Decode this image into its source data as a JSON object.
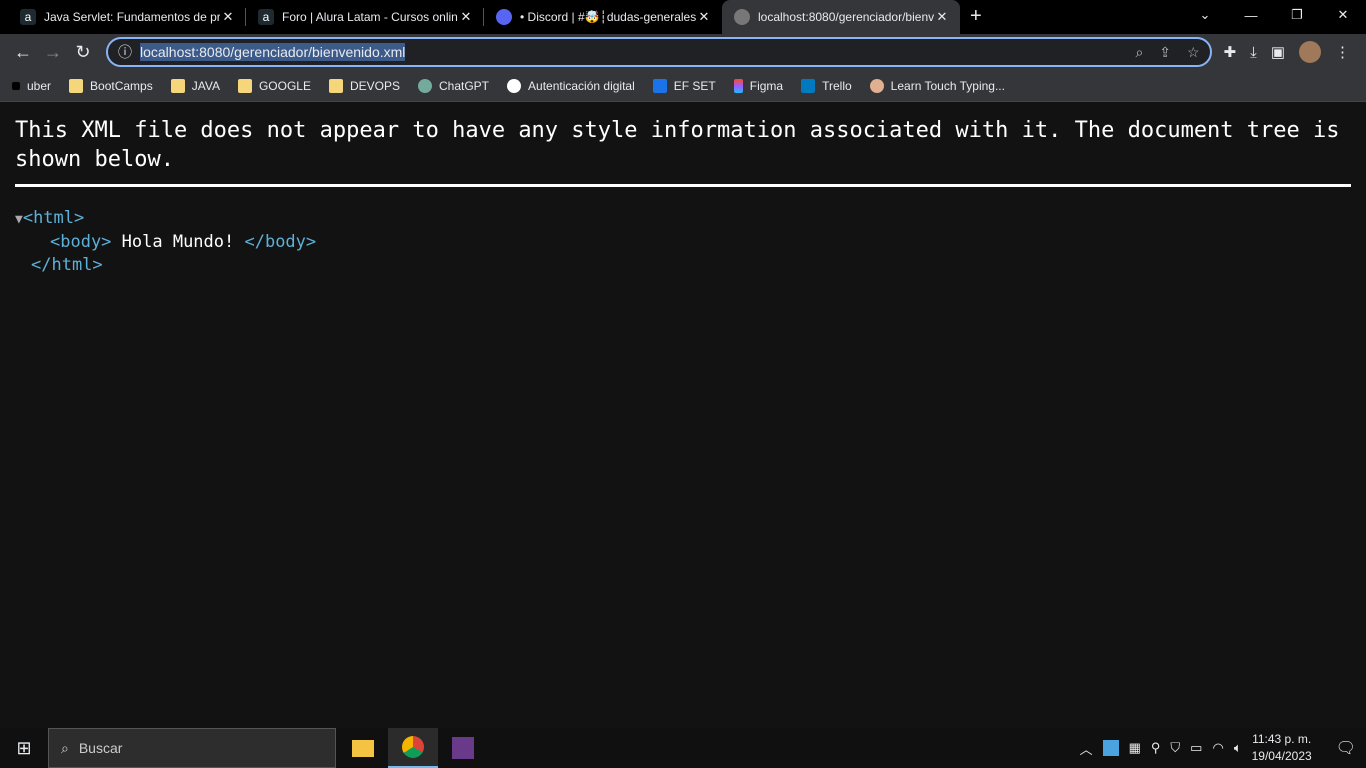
{
  "tabs": [
    {
      "title": "Java Servlet: Fundamentos de pro",
      "icon": "alura-icon"
    },
    {
      "title": "Foro | Alura Latam - Cursos onlin",
      "icon": "alura-icon"
    },
    {
      "title": "• Discord | #🤯┆dudas-generales",
      "icon": "discord-icon"
    },
    {
      "title": "localhost:8080/gerenciador/bienv",
      "icon": "globe-icon",
      "active": true
    }
  ],
  "address": {
    "url": "localhost:8080/gerenciador/bienvenido.xml"
  },
  "bookmarks": [
    "uber",
    "BootCamps",
    "JAVA",
    "GOOGLE",
    "DEVOPS",
    "ChatGPT",
    "Autenticación digital",
    "EF SET",
    "Figma",
    "Trello",
    "Learn Touch Typing..."
  ],
  "page": {
    "notice": "This XML file does not appear to have any style information associated with it. The document tree is shown below.",
    "html_open": "<html>",
    "body_open": "<body>",
    "body_text": " Hola Mundo! ",
    "body_close": "</body>",
    "html_close": "</html>"
  },
  "taskbar": {
    "search_placeholder": "Buscar",
    "time": "11:43 p. m.",
    "date": "19/04/2023"
  },
  "colors": {
    "tag": "#5db0d7",
    "accent": "#8ab4f8"
  }
}
